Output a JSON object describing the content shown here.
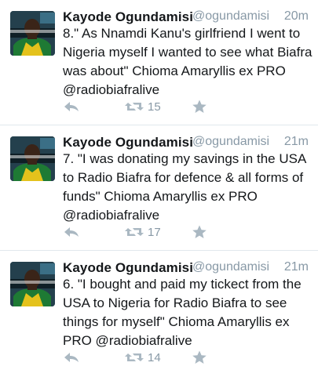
{
  "colors": {
    "text": "#14171a",
    "muted": "#8899a6",
    "icon": "#aab8c2",
    "divider": "#e1e8ed"
  },
  "tweets": [
    {
      "name": "Kayode Ogundamisi",
      "handle": "@ogundamisi",
      "time": "20m",
      "text": "8.\" As Nnamdi Kanu's girlfriend I went to Nigeria myself I wanted to see what Biafra was about\" Chioma Amaryllis ex PRO @radiobiafralive",
      "retweets": "15",
      "icons": [
        "reply-icon",
        "retweet-icon",
        "star-icon"
      ]
    },
    {
      "name": "Kayode Ogundamisi",
      "handle": "@ogundamisi",
      "time": "21m",
      "text": "7. \"I was donating my savings in the USA to Radio Biafra for defence & all forms of funds\" Chioma Amaryllis ex PRO @radiobiafralive",
      "retweets": "17",
      "icons": [
        "reply-icon",
        "retweet-icon",
        "star-icon"
      ]
    },
    {
      "name": "Kayode Ogundamisi",
      "handle": "@ogundamisi",
      "time": "21m",
      "text": "6. \"I bought and paid my tickect from the USA to Nigeria for Radio Biafra to see things for myself\" Chioma Amaryllis ex PRO @radiobiafralive",
      "retweets": "14",
      "icons": [
        "reply-icon",
        "retweet-icon",
        "star-icon"
      ]
    }
  ]
}
